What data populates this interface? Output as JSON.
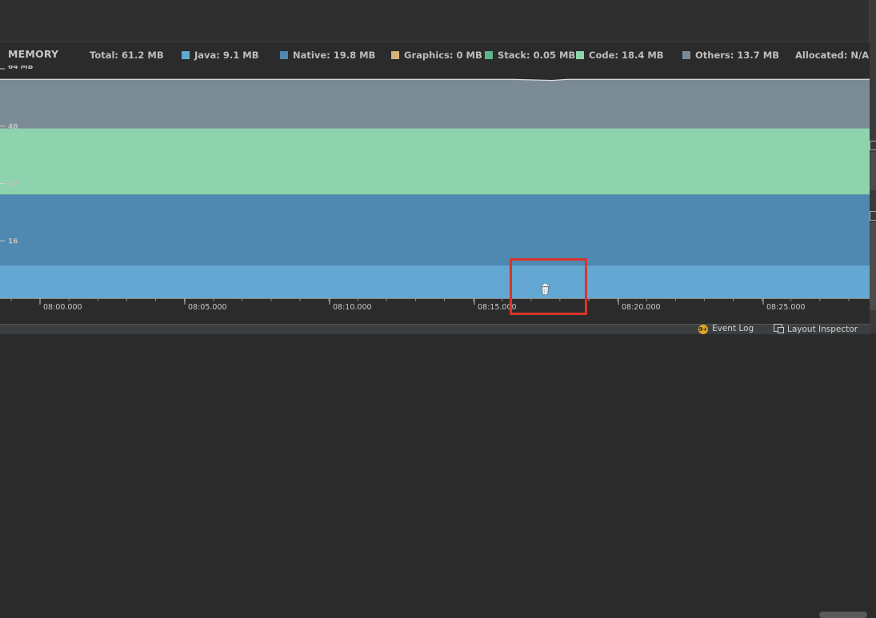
{
  "panel": {
    "title": "MEMORY",
    "total": "Total: 61.2 MB",
    "allocated": "Allocated: N/A"
  },
  "legend": [
    {
      "label": "Java: 9.1 MB",
      "color": "#62a8d2"
    },
    {
      "label": "Native: 19.8 MB",
      "color": "#4f88b0"
    },
    {
      "label": "Graphics: 0 MB",
      "color": "#d4b27a"
    },
    {
      "label": "Stack: 0.05 MB",
      "color": "#5fb38a"
    },
    {
      "label": "Code: 18.4 MB",
      "color": "#8dd3ae"
    },
    {
      "label": "Others: 13.7 MB",
      "color": "#7b8b96"
    }
  ],
  "colors": {
    "java": "#62a8d2",
    "native": "#4f88b0",
    "stack": "#5fb38a",
    "code": "#8dd3ae",
    "others": "#7b8b96",
    "highlight": "#d9342b"
  },
  "chart_data": {
    "type": "area",
    "stacked": true,
    "x": [
      "08:00.000",
      "08:05.000",
      "08:10.000",
      "08:15.000",
      "08:16.500",
      "08:20.000",
      "08:25.000"
    ],
    "y_ticks": [
      "64 MB",
      "48",
      "32",
      "16"
    ],
    "ylim": [
      0,
      64
    ],
    "series": [
      {
        "name": "Java",
        "values": [
          9.1,
          9.1,
          9.1,
          9.1,
          9.1,
          9.1,
          9.1
        ]
      },
      {
        "name": "Native",
        "values": [
          19.8,
          19.8,
          19.8,
          19.8,
          19.8,
          19.8,
          19.8
        ]
      },
      {
        "name": "Graphics",
        "values": [
          0,
          0,
          0,
          0,
          0,
          0,
          0
        ]
      },
      {
        "name": "Stack",
        "values": [
          0.05,
          0.05,
          0.05,
          0.05,
          0.05,
          0.05,
          0.05
        ]
      },
      {
        "name": "Code",
        "values": [
          18.4,
          18.4,
          18.4,
          18.4,
          18.4,
          18.4,
          18.4
        ]
      },
      {
        "name": "Others",
        "values": [
          13.7,
          13.7,
          13.7,
          13.7,
          13.4,
          13.7,
          13.7
        ]
      }
    ]
  },
  "time_axis": {
    "ticks": [
      "08:00.000",
      "08:05.000",
      "08:10.000",
      "08:15.000",
      "08:20.000",
      "08:25.000"
    ]
  },
  "statusbar": {
    "event_log_badge": "9+",
    "event_log": "Event Log",
    "layout_inspector": "Layout Inspector"
  },
  "icons": {
    "gc": "trash-icon",
    "event_log": "event-log-icon",
    "layout_inspector": "layout-inspector-icon"
  }
}
